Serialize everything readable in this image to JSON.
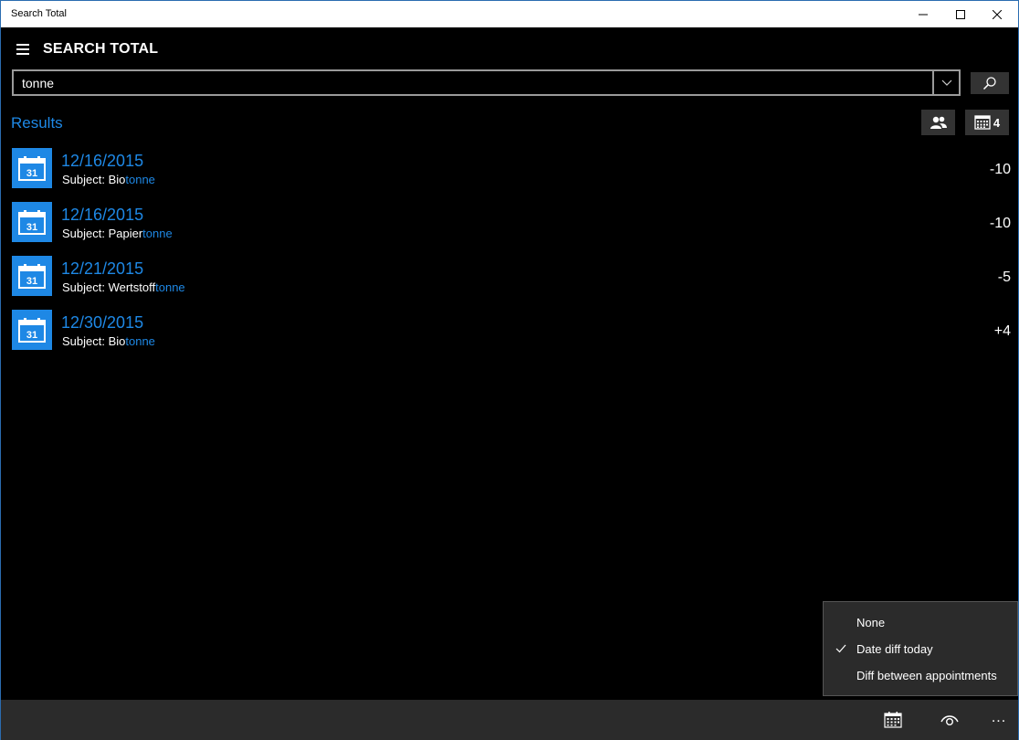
{
  "window": {
    "title": "Search Total"
  },
  "app": {
    "title": "SEARCH TOTAL"
  },
  "search": {
    "value": "tonne"
  },
  "results": {
    "label": "Results",
    "count": "4",
    "items": [
      {
        "tile_day": "31",
        "date": "12/16/2015",
        "subject_prefix": "Subject: Bio",
        "subject_match": "tonne",
        "diff": "-10"
      },
      {
        "tile_day": "31",
        "date": "12/16/2015",
        "subject_prefix": "Subject: Papier",
        "subject_match": "tonne",
        "diff": "-10"
      },
      {
        "tile_day": "31",
        "date": "12/21/2015",
        "subject_prefix": "Subject: Wertstoff",
        "subject_match": "tonne",
        "diff": "-5"
      },
      {
        "tile_day": "31",
        "date": "12/30/2015",
        "subject_prefix": "Subject: Bio",
        "subject_match": "tonne",
        "diff": "+4"
      }
    ]
  },
  "menu": {
    "items": [
      {
        "label": "None",
        "checked": false
      },
      {
        "label": "Date diff today",
        "checked": true
      },
      {
        "label": "Diff between appointments",
        "checked": false
      }
    ]
  },
  "appbar": {
    "more": "..."
  },
  "colors": {
    "accent": "#1e88e5",
    "background": "#000000",
    "surface": "#2b2b2b",
    "button": "#333333"
  },
  "icons": [
    "hamburger-icon",
    "chevron-down-icon",
    "search-icon",
    "people-icon",
    "calendar-icon",
    "check-icon",
    "eye-icon",
    "more-icon"
  ]
}
